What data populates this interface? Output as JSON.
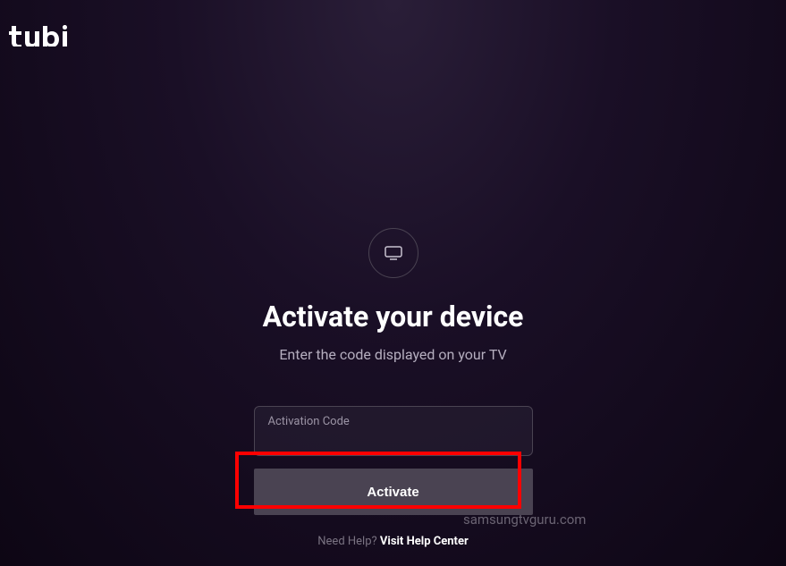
{
  "brand": {
    "name": "tubi"
  },
  "activation": {
    "title": "Activate your device",
    "subtitle": "Enter the code displayed on your TV",
    "input_label": "Activation Code",
    "input_value": "",
    "button_label": "Activate"
  },
  "help": {
    "prompt": "Need Help? ",
    "link_text": "Visit Help Center"
  },
  "watermark": "samsungtvguru.com"
}
